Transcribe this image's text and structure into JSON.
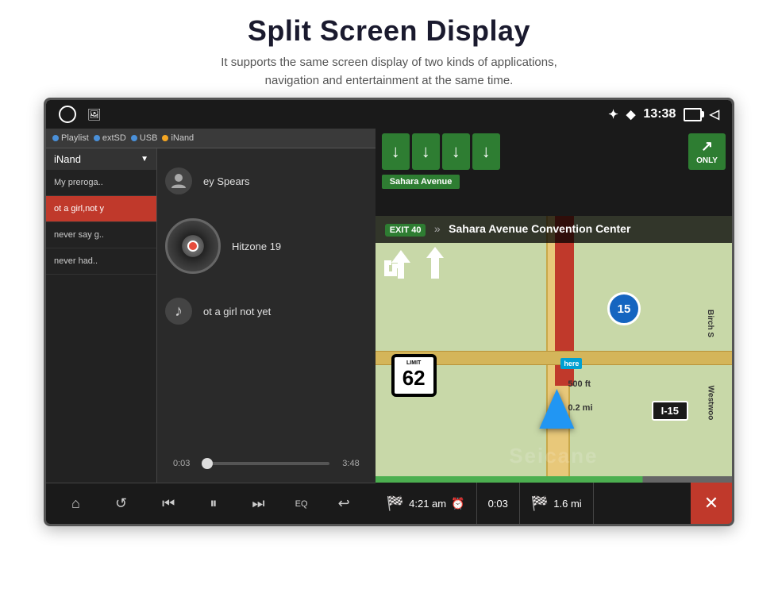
{
  "header": {
    "title": "Split Screen Display",
    "subtitle_line1": "It supports the same screen display of two kinds of applications,",
    "subtitle_line2": "navigation and entertainment at the same time."
  },
  "status_bar": {
    "time": "13:38",
    "bluetooth_icon": "bluetooth",
    "location_icon": "location",
    "battery_icon": "battery",
    "back_icon": "back",
    "home_circle": "○",
    "image_icon": "🖼"
  },
  "music_player": {
    "sources": [
      "Playlist",
      "extSD",
      "USB",
      "iNand"
    ],
    "active_source": "iNand",
    "playlist_header": "iNand",
    "playlist_items": [
      {
        "label": "My preroga..",
        "active": false
      },
      {
        "label": "ot a girl,not y",
        "active": true
      },
      {
        "label": "never say g..",
        "active": false
      },
      {
        "label": "never had..",
        "active": false
      }
    ],
    "track_artist": "ey Spears",
    "track_album": "Hitzone 19",
    "track_title": "ot a girl not yet",
    "progress_current": "0:03",
    "progress_total": "3:48",
    "transport_buttons": [
      "home",
      "repeat",
      "prev",
      "play",
      "next",
      "eq",
      "back"
    ]
  },
  "navigation": {
    "exit_number": "EXIT 40",
    "destination": "Sahara Avenue Convention Center",
    "highway": "I-15",
    "highway_number": "15",
    "speed_limit": "62",
    "eta": "4:21 am",
    "time_remaining": "0:03",
    "distance_remaining": "1.6 mi",
    "turn_distance": "0.2 mi",
    "street_birch": "Birch S",
    "street_west": "Westwoo"
  },
  "watermark": "Seicane"
}
